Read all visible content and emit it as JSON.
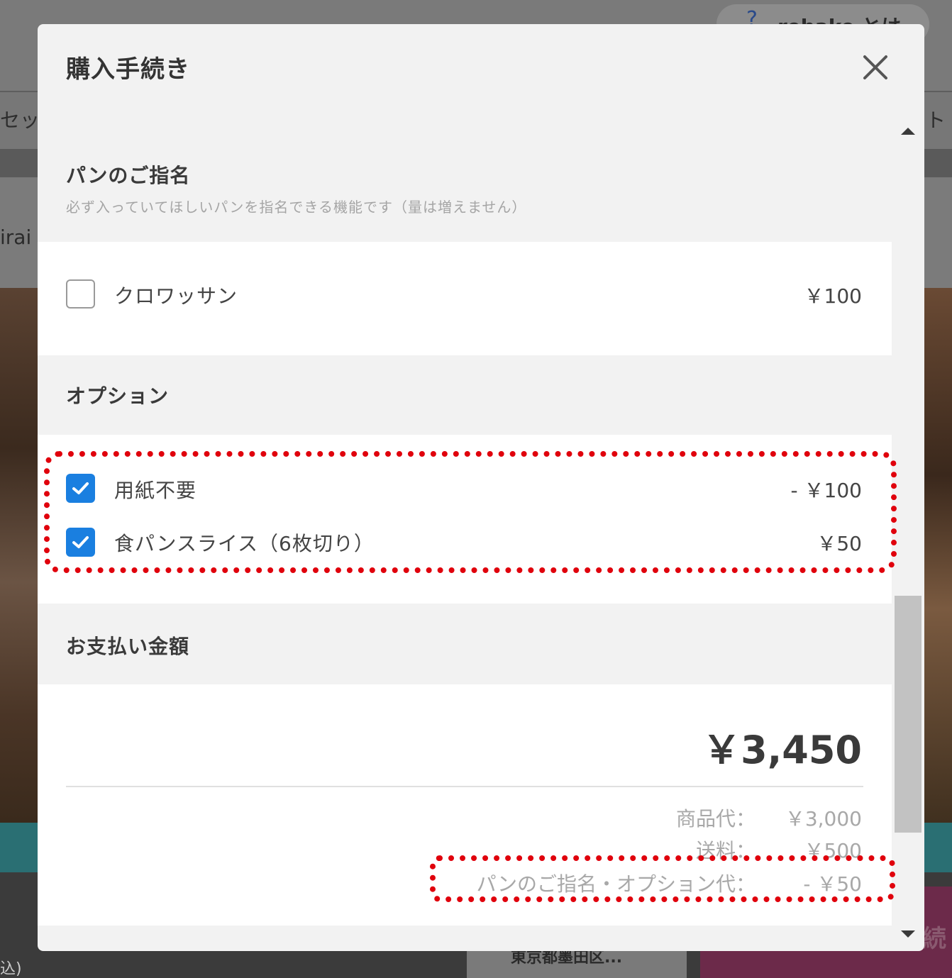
{
  "background": {
    "help_link": "rebake とは",
    "nav_left": "セッ",
    "nav_right": "ト",
    "side_text": "irai",
    "bottom_left": "込)",
    "address": "東京都墨田区...",
    "action_button": "続"
  },
  "modal": {
    "title": "購入手続き",
    "close_icon": "close-icon",
    "designation": {
      "heading": "パンのご指名",
      "subtitle": "必ず入っていてほしいパンを指名できる機能です（量は増えません）",
      "items": [
        {
          "label": "クロワッサン",
          "price": "￥100",
          "checked": false
        }
      ]
    },
    "options": {
      "heading": "オプション",
      "items": [
        {
          "label": "用紙不要",
          "price": "- ￥100",
          "checked": true
        },
        {
          "label": "食パンスライス（6枚切り）",
          "price": "￥50",
          "checked": true
        }
      ]
    },
    "payment": {
      "heading": "お支払い金額",
      "total": "￥3,450",
      "breakdown": [
        {
          "label": "商品代：",
          "value": "￥3,000"
        },
        {
          "label": "送料：",
          "value": "￥500"
        },
        {
          "label": "パンのご指名・オプション代：",
          "value": "- ￥50"
        }
      ]
    }
  },
  "colors": {
    "checkbox_checked": "#1a7fe0",
    "annotation": "#e0000c",
    "overlay": "#6f6f6f"
  }
}
